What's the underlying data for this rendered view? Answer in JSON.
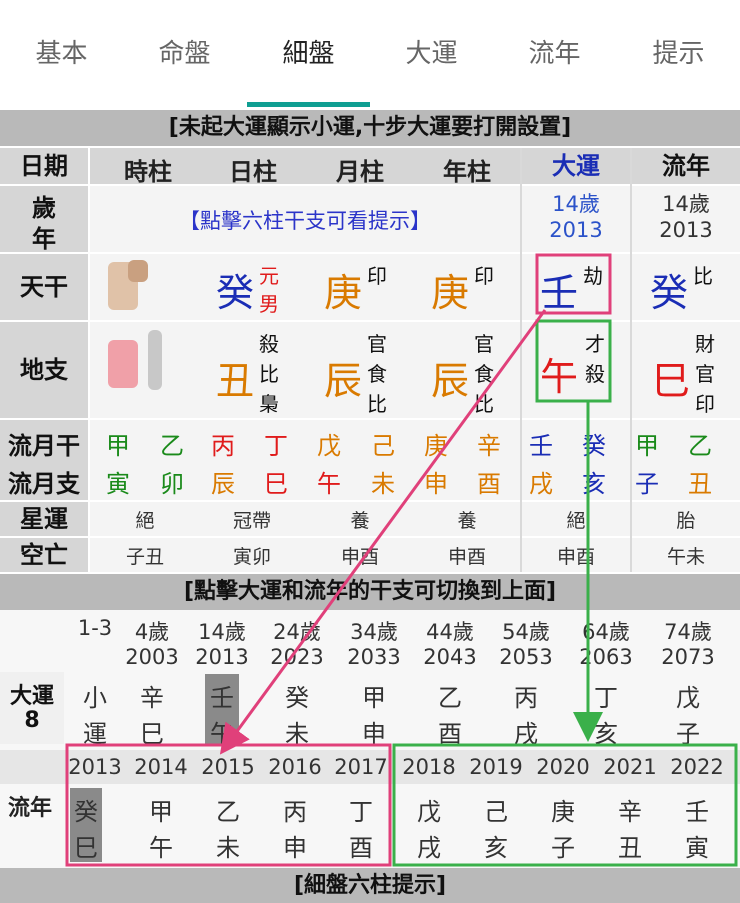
{
  "tabs": [
    "基本",
    "命盤",
    "細盤",
    "大運",
    "流年",
    "提示"
  ],
  "active_tab": "細盤",
  "banner_top": "[未起大運顯示小運,十步大運要打開設置]",
  "headers": {
    "date": "日期",
    "hour": "時柱",
    "day": "日柱",
    "month": "月柱",
    "year": "年柱",
    "dayun": "大運",
    "liunian": "流年"
  },
  "sui_nian": {
    "label_1": "歲",
    "label_2": "年",
    "hint": "【點擊六柱干支可看提示】",
    "dayun_age": "14歲",
    "dayun_year": "2013",
    "liunian_age": "14歲",
    "liunian_year": "2013"
  },
  "tiangan": {
    "label": "天干",
    "day": "癸",
    "day_note_1": "元",
    "day_note_2": "男",
    "month": "庚",
    "month_note": "印",
    "year": "庚",
    "year_note": "印",
    "dayun": "壬",
    "dayun_note": "劫",
    "liunian": "癸",
    "liunian_note": "比"
  },
  "dizhi": {
    "label": "地支",
    "day": "丑",
    "day_notes": [
      "殺",
      "比",
      "梟"
    ],
    "month": "辰",
    "month_notes": [
      "官",
      "食",
      "比"
    ],
    "year": "辰",
    "year_notes": [
      "官",
      "食",
      "比"
    ],
    "dayun": "午",
    "dayun_notes": [
      "才",
      "殺"
    ],
    "liunian": "巳",
    "liunian_notes": [
      "財",
      "官",
      "印"
    ]
  },
  "liuyue": {
    "gan_label": "流月干",
    "zhi_label": "流月支",
    "gan": [
      "甲",
      "乙",
      "丙",
      "丁",
      "戊",
      "己",
      "庚",
      "辛",
      "壬",
      "癸",
      "甲",
      "乙"
    ],
    "zhi": [
      "寅",
      "卯",
      "辰",
      "巳",
      "午",
      "未",
      "申",
      "酉",
      "戌",
      "亥",
      "子",
      "丑"
    ]
  },
  "xingyun": {
    "label": "星運",
    "values": [
      "絕",
      "冠帶",
      "養",
      "養",
      "絕",
      "胎"
    ]
  },
  "kongwang": {
    "label": "空亡",
    "values": [
      "子丑",
      "寅卯",
      "申酉",
      "申酉",
      "申酉",
      "午未"
    ]
  },
  "banner_mid": "[點擊大運和流年的干支可切換到上面]",
  "dayun": {
    "label_1": "大運",
    "label_2": "8",
    "ages": [
      "1-3",
      "4歲",
      "14歲",
      "24歲",
      "34歲",
      "44歲",
      "54歲",
      "64歲",
      "74歲"
    ],
    "years": [
      "",
      "2003",
      "2013",
      "2023",
      "2033",
      "2043",
      "2053",
      "2063",
      "2073"
    ],
    "gan": [
      "小",
      "辛",
      "壬",
      "癸",
      "甲",
      "乙",
      "丙",
      "丁",
      "戊"
    ],
    "zhi": [
      "運",
      "巳",
      "午",
      "未",
      "申",
      "酉",
      "戌",
      "亥",
      "子"
    ]
  },
  "liunian": {
    "label": "流年",
    "years": [
      "2013",
      "2014",
      "2015",
      "2016",
      "2017",
      "2018",
      "2019",
      "2020",
      "2021",
      "2022"
    ],
    "gan": [
      "癸",
      "甲",
      "乙",
      "丙",
      "丁",
      "戊",
      "己",
      "庚",
      "辛",
      "壬"
    ],
    "zhi": [
      "巳",
      "午",
      "未",
      "申",
      "酉",
      "戌",
      "亥",
      "子",
      "丑",
      "寅"
    ]
  },
  "banner_bottom": "[細盤六柱提示]",
  "colors": {
    "accent": "#0f9e92",
    "magenta": "#e0407a",
    "green": "#3ab04a",
    "wood": "#1a8a1a",
    "fire": "#e01b1b",
    "earth": "#d97a00",
    "metal": "#d97a00",
    "water": "#1a2db5"
  }
}
